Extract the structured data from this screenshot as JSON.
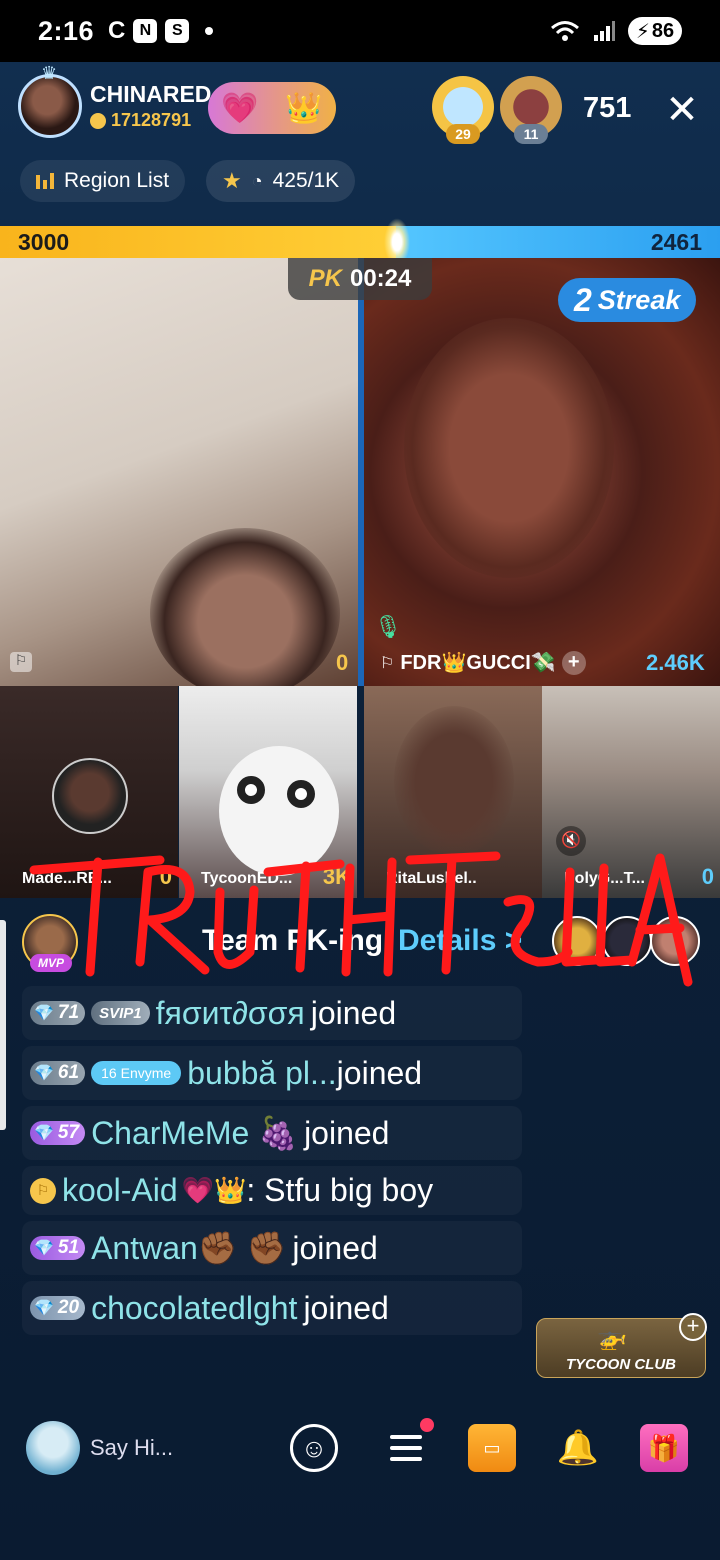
{
  "status_bar": {
    "time": "2:16",
    "left_icons": [
      "C",
      "N",
      "S"
    ],
    "battery": "86",
    "signal_label": "6"
  },
  "host": {
    "name": "CHINARED",
    "coins": "17128791"
  },
  "top_fans": [
    {
      "rank": "29"
    },
    {
      "rank": "11"
    }
  ],
  "viewers": "751",
  "region_list_label": "Region List",
  "task_progress": "425/1K",
  "pk": {
    "left_score": "3000",
    "right_score": "2461",
    "timer_label": "PK",
    "timer": "00:24",
    "streak_number": "2",
    "streak_label": "Streak",
    "left_gift_score": "0",
    "right_name": "FDR👑GUCCI💸",
    "right_gift_score": "2.46K"
  },
  "guests": [
    {
      "name": "Made...RE...",
      "score": "0"
    },
    {
      "name": "TycoonED...",
      "score": "3K"
    },
    {
      "name": "RitaLushel..",
      "score": ""
    },
    {
      "name": "PolyG...T...",
      "score": "0"
    }
  ],
  "team_pk": {
    "mvp_tag": "MVP",
    "label": "Team PK-ing",
    "details": "Details >"
  },
  "watermark": "TRUTHTELLA",
  "chat": [
    {
      "level": "71",
      "svip": "SVIP1",
      "name": "fяσиτ∂σσя",
      "action": "joined"
    },
    {
      "level": "61",
      "club": "Envyme",
      "club_level": "16",
      "name": "bubbă pl...",
      "action": "joined"
    },
    {
      "level": "57",
      "name": "CharMeMe 🍇",
      "action": "joined"
    },
    {
      "name": "kool-Aid",
      "message": ": Stfu big boy"
    },
    {
      "level": "51",
      "name": "Antwan✊🏾 ✊🏾",
      "action": "joined"
    },
    {
      "level": "20",
      "name": "chocolatedlght",
      "action": "joined"
    }
  ],
  "tycoon_label": "TYCOON CLUB",
  "bottom": {
    "say_hi": "Say Hi..."
  },
  "colors": {
    "pk_left": "#f9b41c",
    "pk_right": "#2b9ff0",
    "chat_name": "#8fe3e8",
    "watermark": "#ff1a1a"
  }
}
